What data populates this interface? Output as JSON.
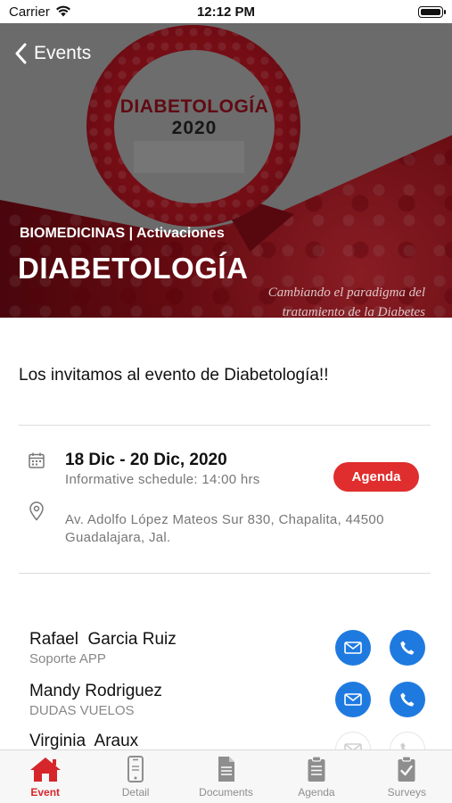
{
  "status_bar": {
    "carrier": "Carrier",
    "time": "12:12 PM"
  },
  "header": {
    "back_label": "Events",
    "badge_title": "DIABETOLOGÍA",
    "badge_year": "2020",
    "category": "BIOMEDICINAS | Activaciones",
    "title": "DIABETOLOGÍA",
    "tagline": "Cambiando el paradigma del tratamiento de la Diabetes"
  },
  "event": {
    "intro": "Los invitamos al evento de Diabetología!!",
    "date": "18 Dic - 20 Dic, 2020",
    "schedule": "Informative schedule: 14:00 hrs",
    "agenda_button": "Agenda",
    "address": "Av. Adolfo López Mateos Sur 830, Chapalita, 44500 Guadalajara, Jal."
  },
  "contacts": [
    {
      "name": "Rafael  Garcia Ruiz",
      "role": "Soporte APP"
    },
    {
      "name": "Mandy Rodriguez",
      "role": "DUDAS VUELOS"
    },
    {
      "name": "Virginia  Araux",
      "role": ""
    }
  ],
  "tabs": [
    {
      "label": "Event",
      "icon": "home-icon",
      "active": true
    },
    {
      "label": "Detail",
      "icon": "phone-icon"
    },
    {
      "label": "Documents",
      "icon": "document-icon"
    },
    {
      "label": "Agenda",
      "icon": "clipboard-icon"
    },
    {
      "label": "Surveys",
      "icon": "checklist-icon"
    }
  ],
  "colors": {
    "accent_red": "#e02d2d",
    "contact_blue": "#1f7ae0",
    "active_tab": "#d6262b",
    "banner_red": "#8e0f18"
  }
}
